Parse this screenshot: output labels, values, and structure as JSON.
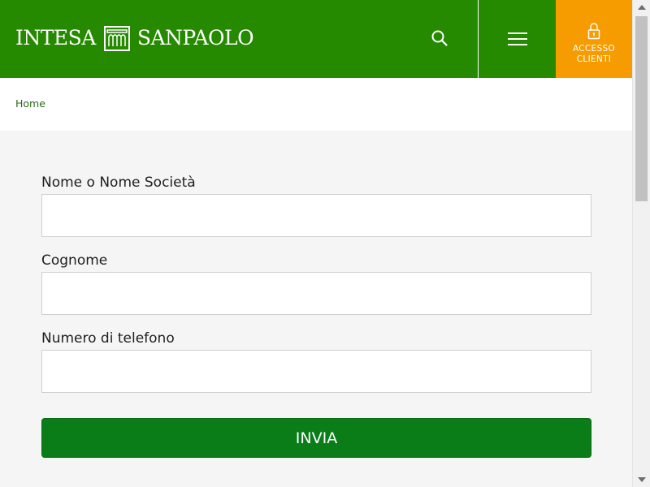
{
  "header": {
    "logo_left": "INTESA",
    "logo_right": "SANPAOLO",
    "search_icon": "search-icon",
    "menu_icon": "hamburger-menu-icon",
    "access_icon": "lock-icon",
    "access_label": "ACCESSO CLIENTI",
    "colors": {
      "primary_green": "#268a00",
      "accent_orange": "#f69b00"
    }
  },
  "breadcrumb": {
    "home": "Home"
  },
  "form": {
    "fields": [
      {
        "label": "Nome o Nome Società",
        "value": ""
      },
      {
        "label": "Cognome",
        "value": ""
      },
      {
        "label": "Numero di telefono",
        "value": ""
      }
    ],
    "submit_label": "INVIA",
    "submit_color": "#0a7d18"
  }
}
